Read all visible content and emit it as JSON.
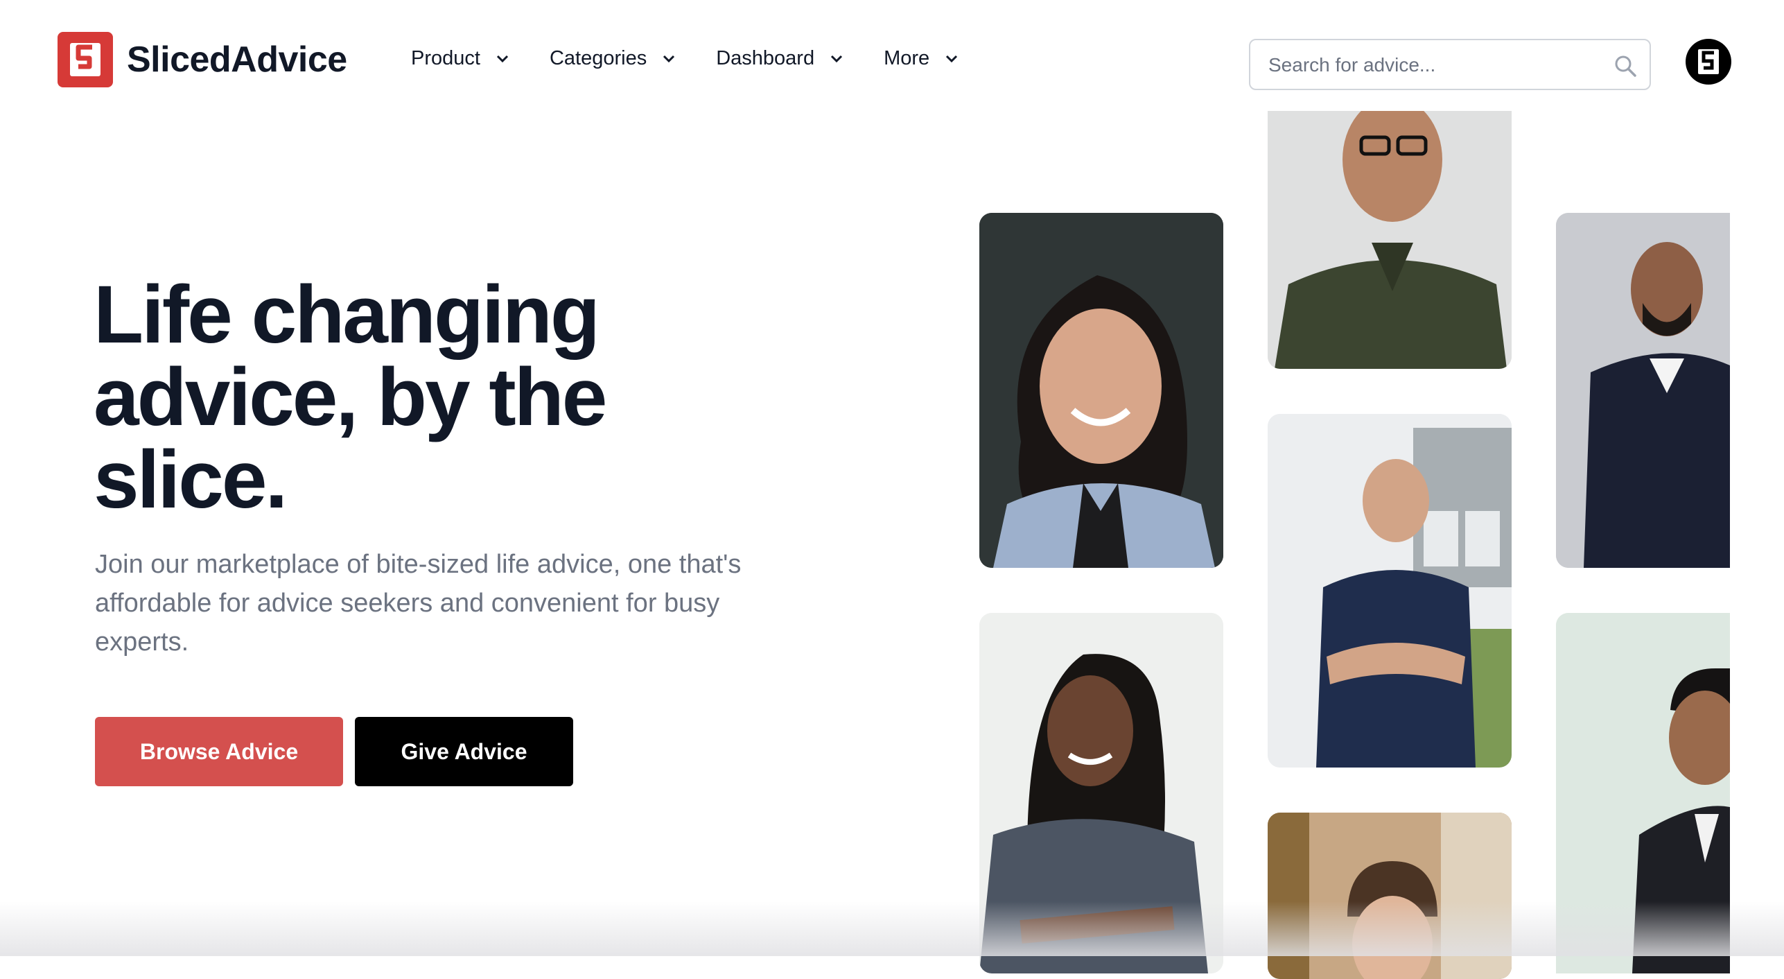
{
  "brand": {
    "name": "SlicedAdvice",
    "logo_color": "#d63a37"
  },
  "nav": {
    "items": [
      {
        "label": "Product",
        "icon": "chevron-down-icon"
      },
      {
        "label": "Categories",
        "icon": "chevron-down-icon"
      },
      {
        "label": "Dashboard",
        "icon": "chevron-down-icon"
      },
      {
        "label": "More",
        "icon": "chevron-down-icon"
      }
    ]
  },
  "search": {
    "placeholder": "Search for advice...",
    "value": "",
    "icon": "search-icon"
  },
  "user": {
    "avatar_icon": "user-avatar-logo"
  },
  "hero": {
    "title": "Life changing advice, by the slice.",
    "subtitle": "Join our marketplace of bite-sized life advice, one that's affordable for advice seekers and convenient for busy experts.",
    "primary_button": "Browse Advice",
    "secondary_button": "Give Advice"
  },
  "colors": {
    "text": "#111827",
    "muted": "#6b7280",
    "browse_button": "#d4504e",
    "give_button": "#000000"
  }
}
